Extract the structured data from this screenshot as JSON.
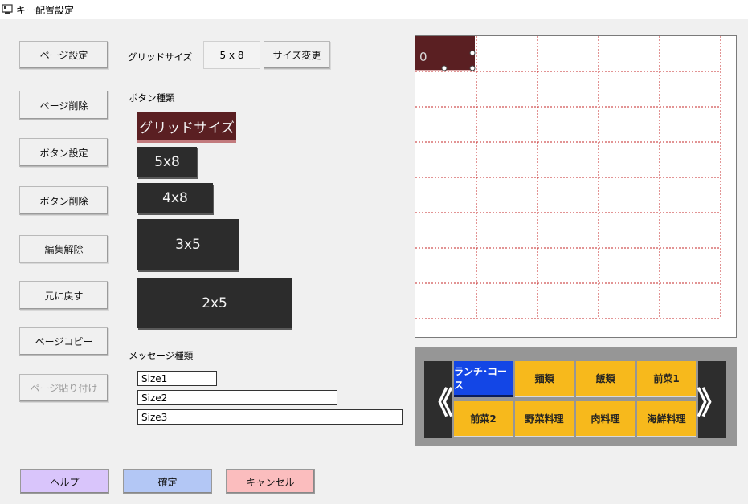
{
  "window": {
    "title": "キー配置設定"
  },
  "left_buttons": [
    {
      "label": "ページ設定",
      "enabled": true
    },
    {
      "label": "ページ削除",
      "enabled": true
    },
    {
      "label": "ボタン設定",
      "enabled": true
    },
    {
      "label": "ボタン削除",
      "enabled": true
    },
    {
      "label": "編集解除",
      "enabled": true
    },
    {
      "label": "元に戻す",
      "enabled": true
    },
    {
      "label": "ページコピー",
      "enabled": true
    },
    {
      "label": "ページ貼り付け",
      "enabled": false
    }
  ],
  "grid_size": {
    "label": "グリッドサイズ",
    "value": "5 x 8",
    "change_button": "サイズ変更"
  },
  "button_types": {
    "label": "ボタン種類",
    "header": "グリッドサイズ",
    "items": [
      "5x8",
      "4x8",
      "3x5",
      "2x5"
    ]
  },
  "message_types": {
    "label": "メッセージ種類",
    "items": [
      "Size1",
      "Size2",
      "Size3"
    ]
  },
  "grid_preview": {
    "cell_label": "0",
    "columns": 5,
    "rows": 8,
    "placed_color": "#5a1f22"
  },
  "categories": {
    "prev_arrow": "《",
    "next_arrow": "》",
    "items": [
      "ランチ･コース",
      "麺類",
      "飯類",
      "前菜1",
      "前菜2",
      "野菜料理",
      "肉料理",
      "海鮮料理"
    ],
    "selected_index": 0,
    "colors": {
      "normal": "#f7b91c",
      "selected": "#1346e6"
    }
  },
  "footer": {
    "help": "ヘルプ",
    "ok": "確定",
    "cancel": "キャンセル",
    "colors": {
      "help": "#d9c5fb",
      "ok": "#b3c7f5",
      "cancel": "#fbbdbe"
    }
  }
}
